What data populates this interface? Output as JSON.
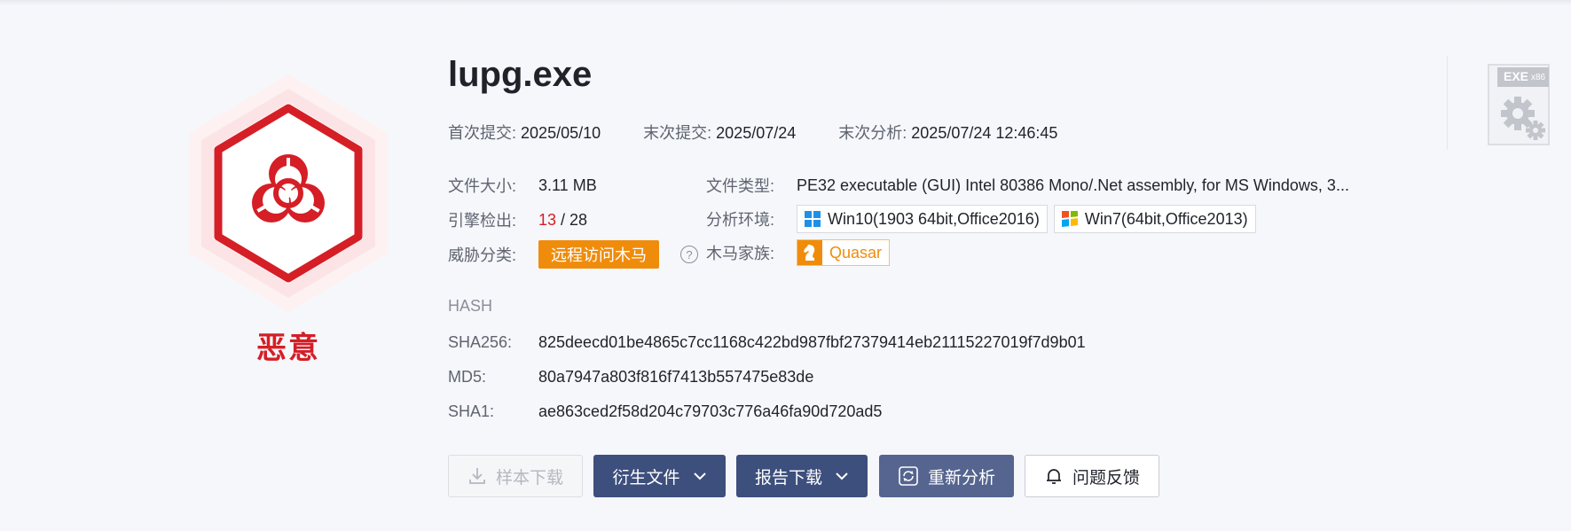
{
  "file": {
    "name": "lupg.exe",
    "verdict": "恶意",
    "type_badge": "EXE",
    "arch_badge": "x86"
  },
  "dates": [
    {
      "label": "首次提交:",
      "value": "2025/05/10"
    },
    {
      "label": "末次提交:",
      "value": "2025/07/24"
    },
    {
      "label": "末次分析:",
      "value": "2025/07/24 12:46:45"
    }
  ],
  "details": {
    "size_label": "文件大小:",
    "size_value": "3.11 MB",
    "type_label": "文件类型:",
    "type_value": "PE32 executable (GUI) Intel 80386 Mono/.Net assembly, for MS Windows, 3...",
    "engines_label": "引擎检出:",
    "engines_hits": "13",
    "engines_sep": " / ",
    "engines_total": "28",
    "env_label": "分析环境:",
    "envs": [
      {
        "name": "Win10(1903 64bit,Office2016)",
        "icon": "windows10-icon"
      },
      {
        "name": "Win7(64bit,Office2013)",
        "icon": "windows7-icon"
      }
    ],
    "threat_label": "威胁分类:",
    "threat_value": "远程访问木马",
    "family_label": "木马家族:",
    "family_value": "Quasar"
  },
  "hash": {
    "title": "HASH",
    "sha256_label": "SHA256:",
    "sha256": "825deecd01be4865c7cc1168c422bd987fbf27379414eb21115227019f7d9b01",
    "md5_label": "MD5:",
    "md5": "80a7947a803f816f7413b557475e83de",
    "sha1_label": "SHA1:",
    "sha1": "ae863ced2f58d204c79703c776a46fa90d720ad5"
  },
  "actions": {
    "download_sample": "样本下载",
    "derived_files": "衍生文件",
    "report_download": "报告下载",
    "reanalyze": "重新分析",
    "feedback": "问题反馈"
  },
  "colors": {
    "malicious_red": "#d51e26",
    "accent_orange": "#f08c0b",
    "button_dark": "#3d4f7d"
  }
}
